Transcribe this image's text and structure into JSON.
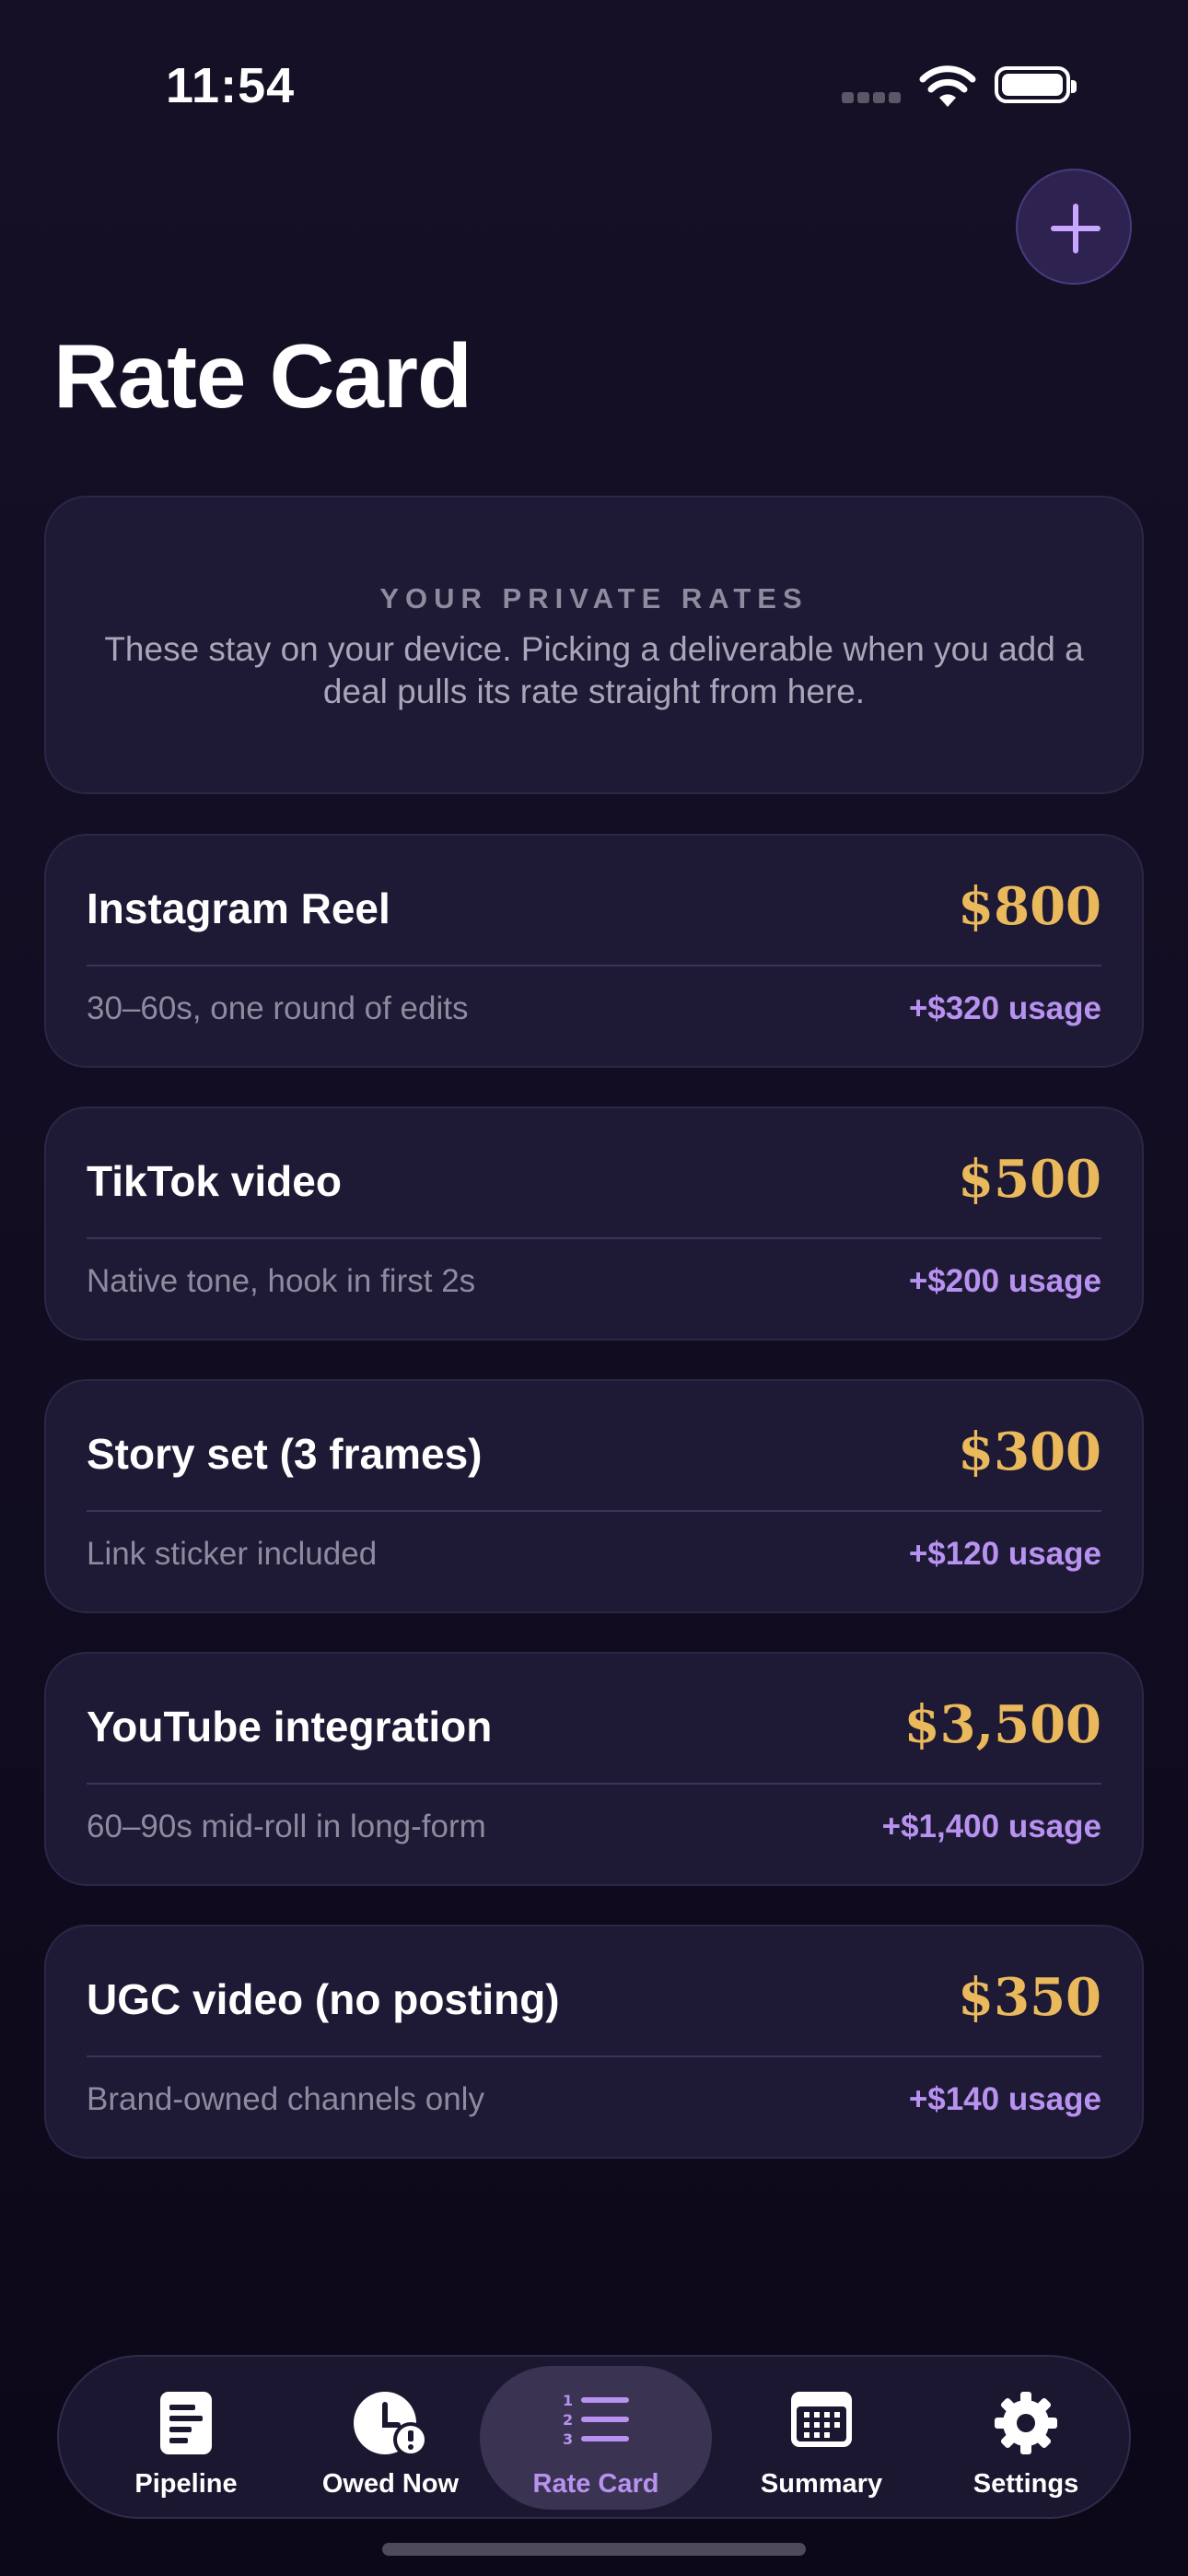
{
  "status": {
    "time": "11:54"
  },
  "header": {
    "title": "Rate Card",
    "add_icon": "plus-icon"
  },
  "info": {
    "heading": "YOUR PRIVATE RATES",
    "body": "These stay on your device. Picking a deliverable when you add a deal pulls its rate straight from here."
  },
  "rates": [
    {
      "name": "Instagram Reel",
      "price": "$800",
      "desc": "30–60s, one round of edits",
      "usage": "+$320 usage"
    },
    {
      "name": "TikTok video",
      "price": "$500",
      "desc": "Native tone, hook in first 2s",
      "usage": "+$200 usage"
    },
    {
      "name": "Story set (3 frames)",
      "price": "$300",
      "desc": "Link sticker included",
      "usage": "+$120 usage"
    },
    {
      "name": "YouTube integration",
      "price": "$3,500",
      "desc": "60–90s mid-roll in long-form",
      "usage": "+$1,400 usage"
    },
    {
      "name": "UGC video (no posting)",
      "price": "$350",
      "desc": "Brand-owned channels only",
      "usage": "+$140 usage"
    }
  ],
  "tabs": [
    {
      "label": "Pipeline",
      "icon": "document-icon",
      "active": false
    },
    {
      "label": "Owed Now",
      "icon": "clock-alert-icon",
      "active": false
    },
    {
      "label": "Rate Card",
      "icon": "numbered-list-icon",
      "active": true
    },
    {
      "label": "Summary",
      "icon": "calendar-icon",
      "active": false
    },
    {
      "label": "Settings",
      "icon": "gear-icon",
      "active": false
    }
  ],
  "colors": {
    "background": "#161027",
    "card": "#1e1934",
    "price": "#e9b95c",
    "accent": "#b892f0",
    "muted_text": "#8f8a9e"
  }
}
